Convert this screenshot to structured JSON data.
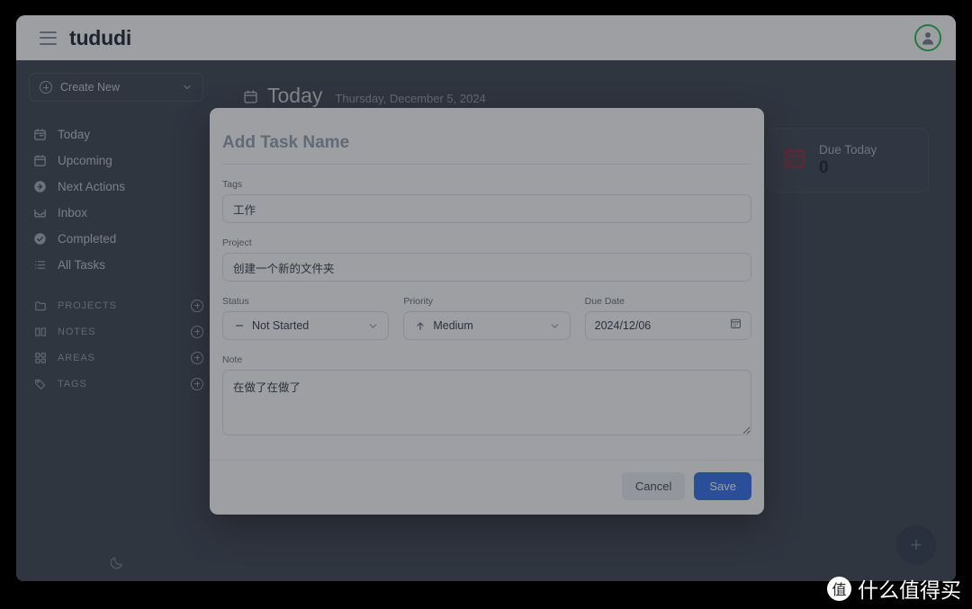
{
  "topbar": {
    "brand": "tududi",
    "menu_icon": "hamburger-icon",
    "avatar_icon": "user-avatar-icon",
    "avatar_ring_color": "#2fbd63"
  },
  "sidebar": {
    "create_new": {
      "label": "Create New",
      "icon": "circle-plus-icon",
      "chevron": "chevron-down-icon"
    },
    "nav_items": [
      {
        "label": "Today",
        "icon": "calendar-today-icon"
      },
      {
        "label": "Upcoming",
        "icon": "calendar-icon"
      },
      {
        "label": "Next Actions",
        "icon": "arrow-right-circle-icon"
      },
      {
        "label": "Inbox",
        "icon": "inbox-icon"
      },
      {
        "label": "Completed",
        "icon": "check-circle-icon"
      },
      {
        "label": "All Tasks",
        "icon": "list-icon"
      }
    ],
    "sections": [
      {
        "label": "PROJECTS",
        "icon": "folder-icon",
        "add_icon": "circle-plus-icon"
      },
      {
        "label": "NOTES",
        "icon": "book-icon",
        "add_icon": "circle-plus-icon"
      },
      {
        "label": "AREAS",
        "icon": "grid-icon",
        "add_icon": "circle-plus-icon"
      },
      {
        "label": "TAGS",
        "icon": "tag-icon",
        "add_icon": "circle-plus-icon"
      }
    ],
    "darkmode_icon": "moon-icon"
  },
  "main": {
    "page_icon": "calendar-icon",
    "page_title": "Today",
    "page_date": "Thursday, December 5, 2024",
    "stat_cards": [
      {
        "title": "Due Today",
        "value": "0",
        "icon": "calendar-red-icon",
        "icon_color": "#9d3040"
      }
    ],
    "fab": {
      "icon": "plus-icon",
      "label": "+"
    }
  },
  "modal": {
    "task_name": {
      "value": "",
      "placeholder": "Add Task Name"
    },
    "tags": {
      "label": "Tags",
      "value": "工作"
    },
    "project": {
      "label": "Project",
      "value": "创建一个新的文件夹"
    },
    "status": {
      "label": "Status",
      "value": "Not Started",
      "glyph": "minus-icon",
      "chevron": "chevron-down-icon"
    },
    "priority": {
      "label": "Priority",
      "value": "Medium",
      "glyph": "arrow-up-icon",
      "chevron": "chevron-down-icon"
    },
    "due_date": {
      "label": "Due Date",
      "value": "2024/12/06",
      "icon": "calendar-picker-icon"
    },
    "note": {
      "label": "Note",
      "value": "在做了在做了"
    },
    "cancel_label": "Cancel",
    "save_label": "Save",
    "save_color": "#3b74ef"
  },
  "watermark": {
    "logo": "值",
    "text": "什么值得买"
  }
}
